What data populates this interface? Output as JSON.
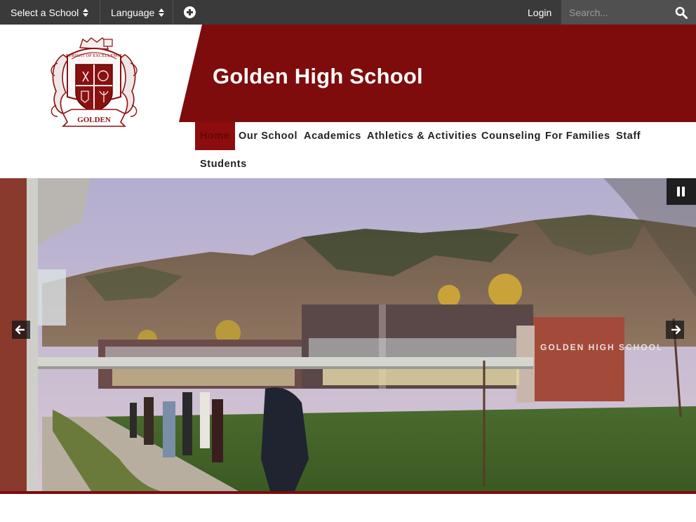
{
  "topbar": {
    "select_school": "Select a School",
    "language": "Language",
    "login": "Login",
    "search_placeholder": "Search..."
  },
  "header": {
    "school_name": "Golden High School",
    "logo_text": "GOLDEN",
    "logo_motto": "PURSUIT OF EXCELLENCE"
  },
  "nav": {
    "items": [
      {
        "label": "Home",
        "active": true
      },
      {
        "label": "Our School"
      },
      {
        "label": "Academics"
      },
      {
        "label": "Athletics & Activities"
      },
      {
        "label": "Counseling"
      },
      {
        "label": "For Families"
      },
      {
        "label": "Staff"
      },
      {
        "label": "Students"
      }
    ]
  },
  "hero": {
    "building_sign": "GOLDEN HIGH SCHOOL"
  },
  "icons": {
    "select_school": "up-down-caret-icon",
    "language": "up-down-caret-icon",
    "add": "plus-circle-icon",
    "search": "search-icon",
    "pause": "pause-icon",
    "prev": "arrow-left-icon",
    "next": "arrow-right-icon"
  },
  "colors": {
    "topbar": "#3a3a3a",
    "brand_maroon": "#7e0c0c",
    "active_nav": "#8b0d0d"
  }
}
